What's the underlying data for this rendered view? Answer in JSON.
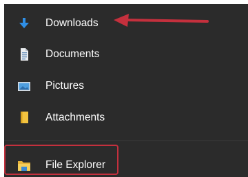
{
  "quick_access": {
    "items": [
      {
        "label": "Downloads",
        "icon": "download-arrow-icon"
      },
      {
        "label": "Documents",
        "icon": "document-icon"
      },
      {
        "label": "Pictures",
        "icon": "pictures-icon"
      },
      {
        "label": "Attachments",
        "icon": "folder-icon"
      }
    ],
    "pinned": {
      "label": "File Explorer",
      "icon": "file-explorer-icon"
    }
  },
  "colors": {
    "panel_background": "#2b2b2b",
    "text": "#ffffff",
    "annotation_red": "#c4303d",
    "download_blue": "#2f8fe6",
    "folder_yellow": "#f3c33f"
  }
}
